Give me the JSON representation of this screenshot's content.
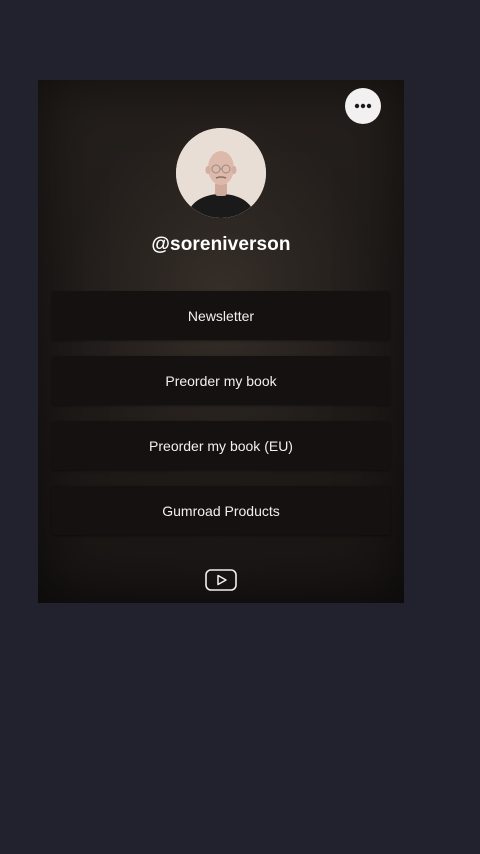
{
  "profile": {
    "username": "@soreniverson"
  },
  "links": [
    {
      "label": "Newsletter"
    },
    {
      "label": "Preorder my book"
    },
    {
      "label": "Preorder my book (EU)"
    },
    {
      "label": "Gumroad Products"
    }
  ],
  "icons": {
    "menu": "more-horizontal-icon",
    "social": "youtube-icon"
  },
  "colors": {
    "page_background": "#22212e",
    "card_background": "#1e1a18",
    "button_background": "#151110",
    "text": "#ffffff"
  }
}
